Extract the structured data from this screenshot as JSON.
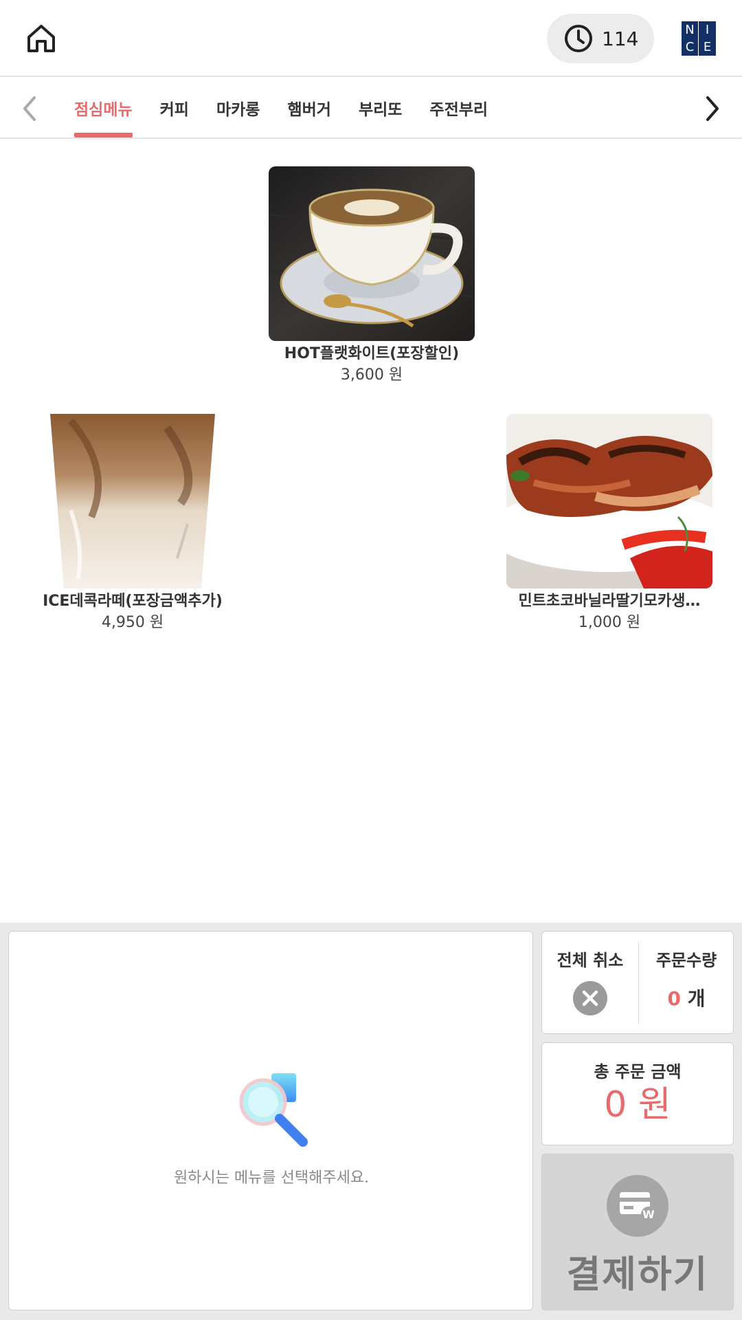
{
  "header": {
    "home_icon": "home-icon",
    "timer_icon": "clock-icon",
    "timer_value": "114",
    "logo": {
      "top_left": "N",
      "top_right": "I",
      "bottom_left": "C",
      "bottom_right": "E",
      "color": "#123066"
    }
  },
  "tabs": {
    "prev_icon": "chevron-left-icon",
    "next_icon": "chevron-right-icon",
    "items": [
      {
        "label": "점심메뉴",
        "active": true
      },
      {
        "label": "커피",
        "active": false
      },
      {
        "label": "마카롱",
        "active": false
      },
      {
        "label": "햄버거",
        "active": false
      },
      {
        "label": "부리또",
        "active": false
      },
      {
        "label": "주전부리",
        "active": false
      }
    ],
    "accent_color": "#e86a6a"
  },
  "menu": {
    "items": [
      {
        "name": "HOT플랫화이트(포장할인)",
        "price": "3,600 원",
        "image": "hot-coffee-cup-photo"
      },
      {
        "name": "ICE데콕라떼(포장금액추가)",
        "price": "4,950 원",
        "image": "iced-latte-cup-photo"
      },
      {
        "name": "민트초코바닐라딸기모카생…",
        "price": "1,000 원",
        "image": "grilled-chicken-wings-photo"
      }
    ]
  },
  "order": {
    "cart_empty_message": "원하시는 메뉴를 선택해주세요.",
    "cart_icon": "search-magnifier-icon",
    "cancel_all_label": "전체 취소",
    "cancel_icon": "close-circle-icon",
    "quantity_label": "주문수량",
    "quantity_value": "0",
    "quantity_unit": "개",
    "total_label": "총 주문 금액",
    "total_value": "0 원",
    "pay_label": "결제하기",
    "pay_icon": "card-won-icon"
  }
}
